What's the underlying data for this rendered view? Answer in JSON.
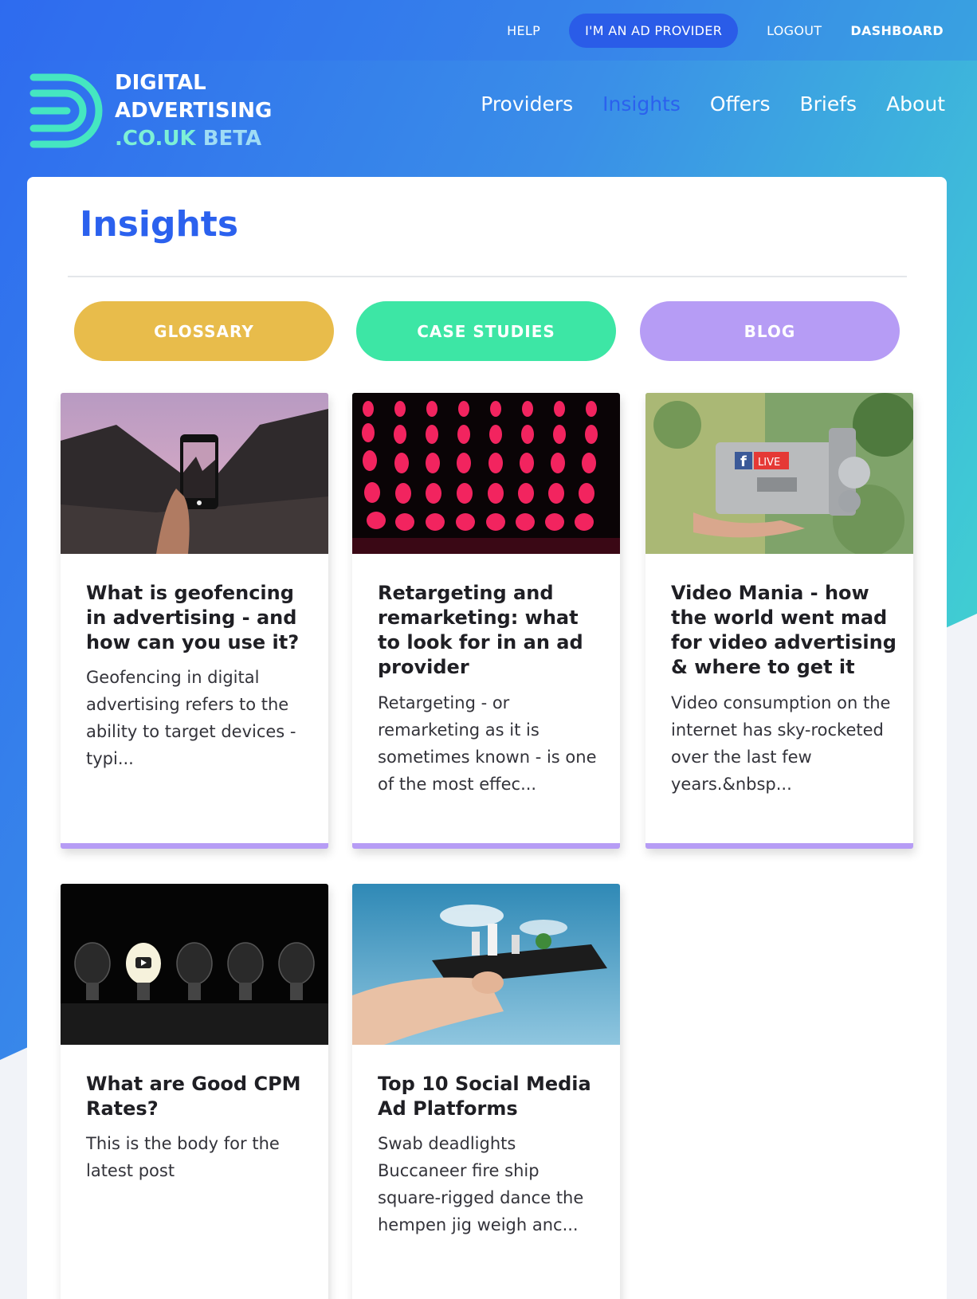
{
  "topbar": {
    "help": "HELP",
    "ad_provider": "I'M AN AD PROVIDER",
    "logout": "LOGOUT",
    "dashboard": "DASHBOARD"
  },
  "logo": {
    "line1": "DIGITAL",
    "line2": "ADVERTISING",
    "line3": ".CO.UK",
    "beta": "BETA"
  },
  "nav": {
    "items": [
      {
        "label": "Providers"
      },
      {
        "label": "Insights",
        "active": true
      },
      {
        "label": "Offers"
      },
      {
        "label": "Briefs"
      },
      {
        "label": "About"
      }
    ]
  },
  "main": {
    "title": "Insights",
    "categories": [
      {
        "label": "GLOSSARY",
        "color": "#e8bc4b"
      },
      {
        "label": "CASE STUDIES",
        "color": "#3de6a5"
      },
      {
        "label": "BLOG",
        "color": "#b69cf5"
      }
    ],
    "cards": [
      {
        "title": "What is geofencing in advertising - and how can you use it?",
        "body": "Geofencing in digital advertising refers to the ability to target devices - typi..."
      },
      {
        "title": "Retargeting and remarketing: what to look for in an ad provider",
        "body": "Retargeting - or remarketing as it is sometimes known - is one of the most effec..."
      },
      {
        "title": "Video Mania - how the world went mad for video advertising & where to get it",
        "body": "Video consumption on the internet has sky-rocketed over the last few years.&nbsp..."
      },
      {
        "title": "What are Good CPM Rates?",
        "body": "This is the body for the latest post"
      },
      {
        "title": "Top 10 Social Media Ad Platforms",
        "body": "Swab deadlights Buccaneer fire ship square-rigged dance the hempen jig weigh anc..."
      }
    ],
    "card_accent": "#b69cf5",
    "live_badge": "LIVE"
  },
  "colors": {
    "brand_blue": "#2b61ee",
    "teal": "#45e6c1"
  }
}
